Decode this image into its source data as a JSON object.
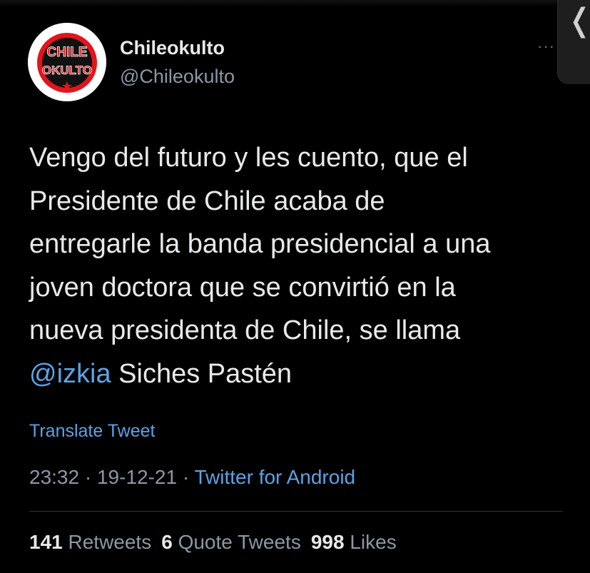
{
  "account": {
    "display_name": "Chileokulto",
    "handle": "@Chileokulto",
    "avatar_text_top": "CHILE",
    "avatar_text_bottom": "OKULTO",
    "avatar_colors": {
      "ring": "#e3141b",
      "bg": "#ffffff",
      "text": "#e3141b"
    }
  },
  "tweet": {
    "lines": [
      "Vengo del futuro y les cuento, que el",
      "Presidente de Chile acaba de",
      "entregarle la banda presidencial a una",
      "joven doctora que se convirtió en la",
      "nueva presidenta de Chile, se llama"
    ],
    "mention": "@izkia",
    "last_line_rest": " Siches Pastén",
    "translate_label": "Translate Tweet"
  },
  "meta": {
    "time": "23:32",
    "separator": " · ",
    "date": "19-12-21",
    "separator2": " · ",
    "source": "Twitter for Android"
  },
  "stats": {
    "retweets_count": "141",
    "retweets_label": " Retweets",
    "quotes_count": "6",
    "quotes_label": " Quote Tweets",
    "likes_count": "998",
    "likes_label": " Likes"
  },
  "more_icon": "more-horizontal-icon",
  "side_icon": "chevron-left-icon",
  "side_glyph": "❬",
  "more_glyph": "···",
  "colors": {
    "accent": "#5ba3e6",
    "bg": "#000000",
    "muted": "#8b98a5",
    "text": "#e7e9ea"
  }
}
